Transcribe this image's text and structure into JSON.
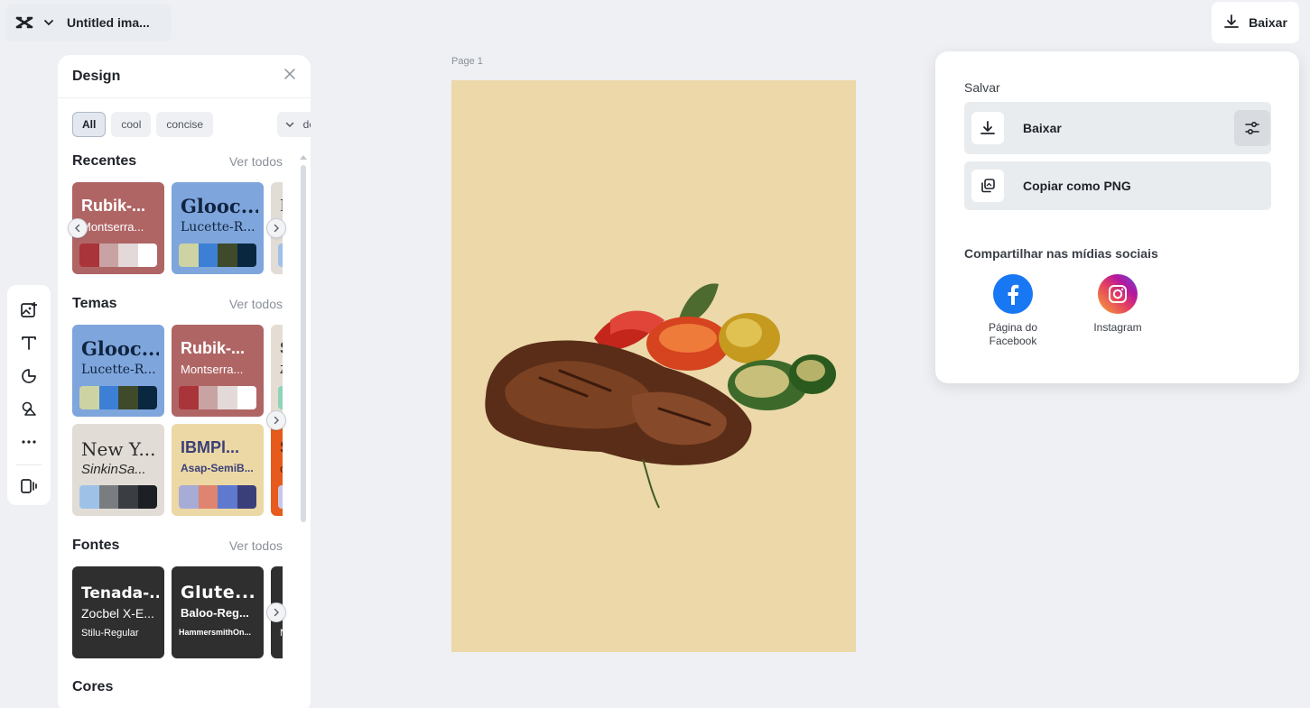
{
  "header": {
    "document_title": "Untitled ima...",
    "download_label": "Baixar"
  },
  "toolrail": {
    "items": [
      "image-add-icon",
      "text-icon",
      "shapes-icon",
      "elements-icon",
      "more-icon",
      "video-icon"
    ]
  },
  "design_panel": {
    "title": "Design",
    "filters": [
      "All",
      "cool",
      "concise",
      "modern"
    ],
    "active_filter": "All",
    "sections": {
      "recentes": {
        "title": "Recentes",
        "see_all": "Ver todos",
        "cards": [
          {
            "heading": "Rubik-...",
            "sub": "Montserra...",
            "bg": "#b06565",
            "fg": "#ffffff",
            "swatches": [
              "#a9343a",
              "#c9a3a3",
              "#e4d9d9",
              "#ffffff"
            ]
          },
          {
            "heading": "Glooc...",
            "sub": "Lucette-R...",
            "bg": "#7ea6dc",
            "fg": "#10233f",
            "swatches": [
              "#cdd3a3",
              "#3d7fd4",
              "#3e4a2a",
              "#0a2740"
            ]
          },
          {
            "heading": "N",
            "sub": "",
            "bg": "#e2dcd6",
            "fg": "#333333",
            "swatches": [
              "#9ec1e8"
            ]
          }
        ]
      },
      "temas": {
        "title": "Temas",
        "see_all": "Ver todos",
        "cards": [
          {
            "heading": "Glooc...",
            "sub": "Lucette-R...",
            "bg": "#7ea6dc",
            "fg": "#10233f",
            "swatches": [
              "#cdd3a3",
              "#3d7fd4",
              "#3e4a2a",
              "#0a2740"
            ]
          },
          {
            "heading": "Rubik-...",
            "sub": "Montserra...",
            "bg": "#b06565",
            "fg": "#ffffff",
            "swatches": [
              "#a9343a",
              "#c9a3a3",
              "#e4d9d9",
              "#ffffff"
            ]
          },
          {
            "heading": "S",
            "sub": "Z",
            "bg": "#e5ddd3",
            "fg": "#333333",
            "swatches": [
              "#8fd3b8"
            ]
          },
          {
            "heading": "New Y...",
            "sub": "SinkinSa...",
            "bg": "#e2dcd6",
            "fg": "#2a2a2a",
            "swatches": [
              "#9ec1e8",
              "#7a7d80",
              "#3a3d42",
              "#1c1f23"
            ]
          },
          {
            "heading": "IBMPl...",
            "sub": "Asap-SemiB...",
            "bg": "#ecd8a4",
            "fg": "#3a3f7a",
            "swatches": [
              "#a7acd6",
              "#df8470",
              "#5f79cf",
              "#3a3f7a"
            ]
          },
          {
            "heading": "S",
            "sub": "o",
            "bg": "#e65b1c",
            "fg": "#5a1d06",
            "swatches": [
              "#c9c6e8"
            ]
          }
        ]
      },
      "fontes": {
        "title": "Fontes",
        "see_all": "Ver todos",
        "cards": [
          {
            "heading": "Tenada-...",
            "sub": "Zocbel X-E...",
            "small": "Stilu-Regular"
          },
          {
            "heading": "Glute...",
            "sub": "Baloo-Reg...",
            "small": "HammersmithOn..."
          },
          {
            "heading": "",
            "sub": "",
            "small": "N"
          }
        ]
      },
      "cores": {
        "title": "Cores"
      }
    }
  },
  "canvas": {
    "page_label": "Page 1",
    "background": "#ecd8a9"
  },
  "download_popup": {
    "save_label": "Salvar",
    "options": [
      {
        "label": "Baixar",
        "icon": "download-icon"
      },
      {
        "label": "Copiar como PNG",
        "icon": "copy-png-icon"
      }
    ],
    "share_label": "Compartilhar nas mídias sociais",
    "social": [
      {
        "name": "Página do Facebook",
        "color": "#1877f2"
      },
      {
        "name": "Instagram",
        "color": "#d6249f"
      }
    ]
  }
}
